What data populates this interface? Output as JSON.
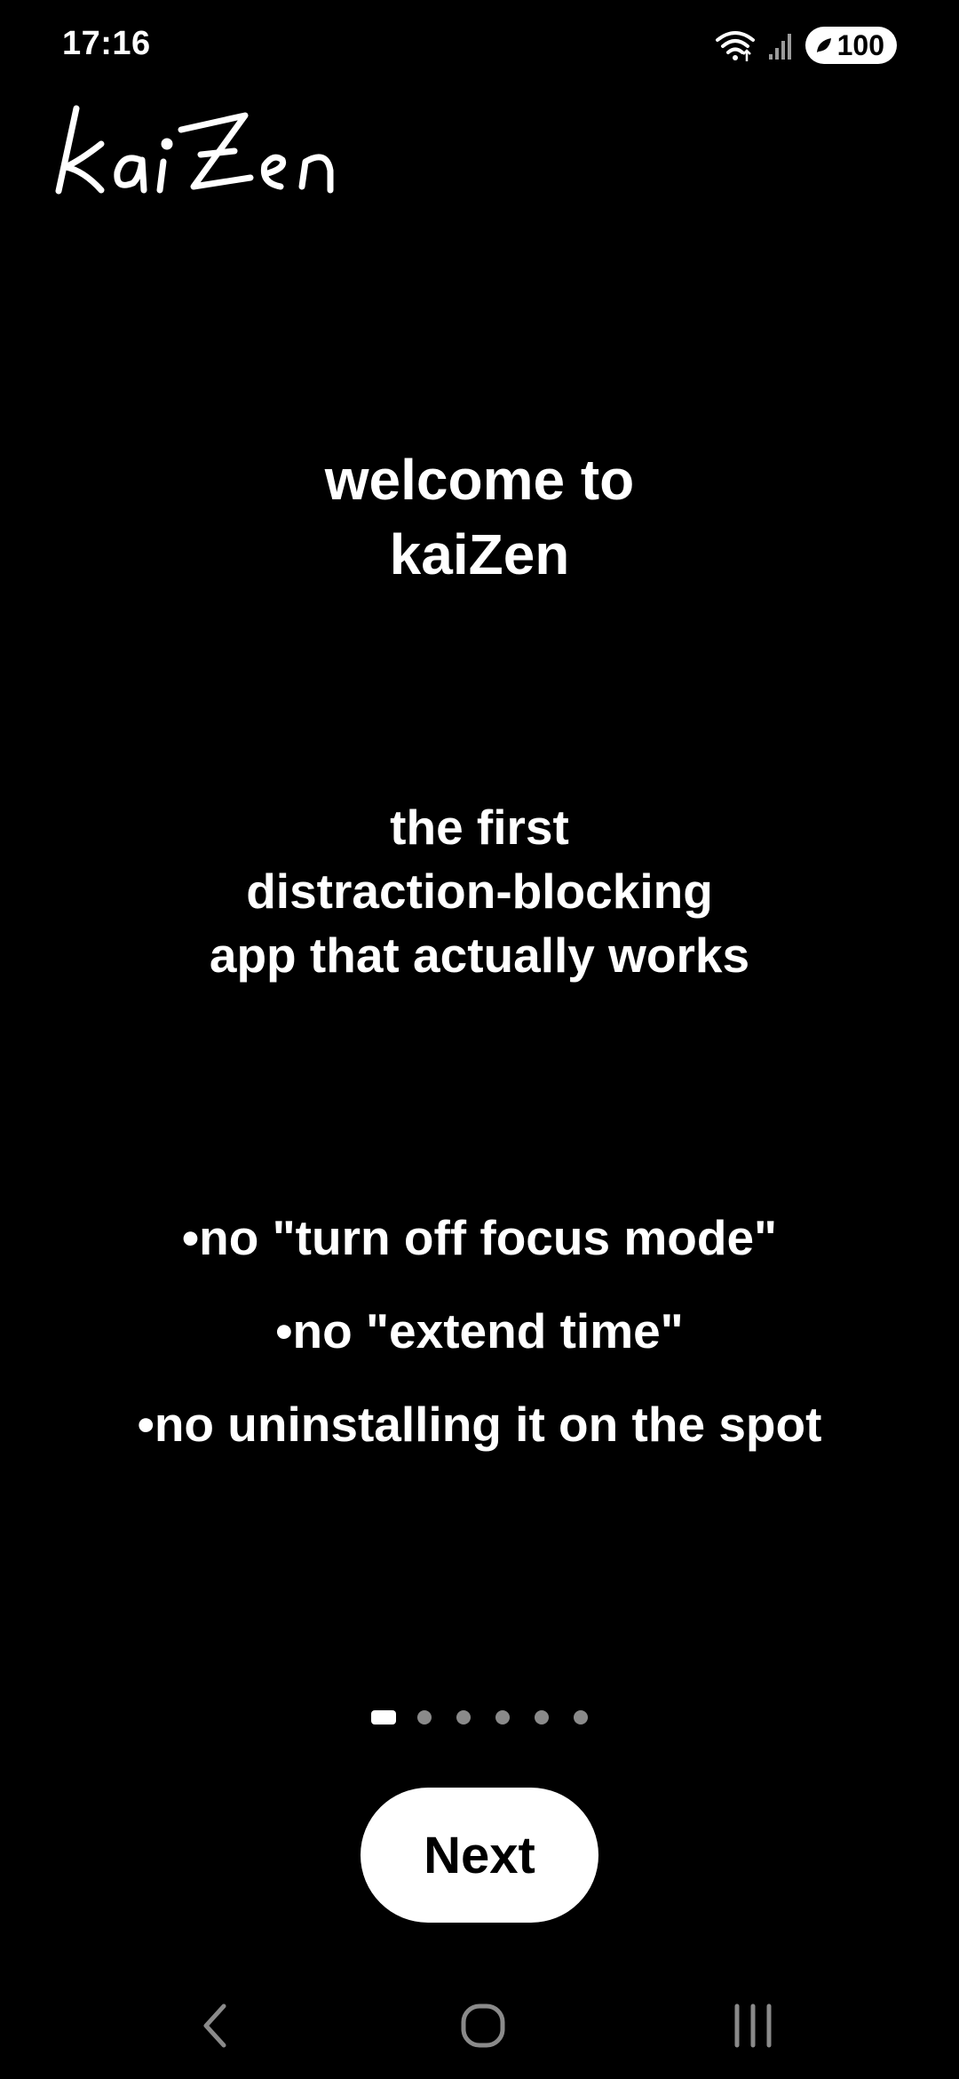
{
  "status_bar": {
    "time": "17:16",
    "icons": [
      "wifi-icon",
      "signal-icon"
    ],
    "battery_level": "100"
  },
  "logo": {
    "text": "kaiZen",
    "style": "handwritten"
  },
  "welcome": {
    "line1": "welcome to",
    "line2": "kaiZen"
  },
  "tagline": {
    "line1": "the first",
    "line2": "distraction-blocking",
    "line3": "app that actually works"
  },
  "features": [
    "•no \"turn off focus mode\"",
    "•no \"extend time\"",
    "•no uninstalling it on the spot"
  ],
  "pager": {
    "total": 6,
    "current": 1
  },
  "next_button": {
    "label": "Next"
  },
  "nav_bar": {
    "icons": [
      "back-icon",
      "home-icon",
      "recents-icon"
    ]
  },
  "colors": {
    "background": "#000000",
    "foreground": "#ffffff",
    "inactive_dot": "#8a8a8a"
  }
}
